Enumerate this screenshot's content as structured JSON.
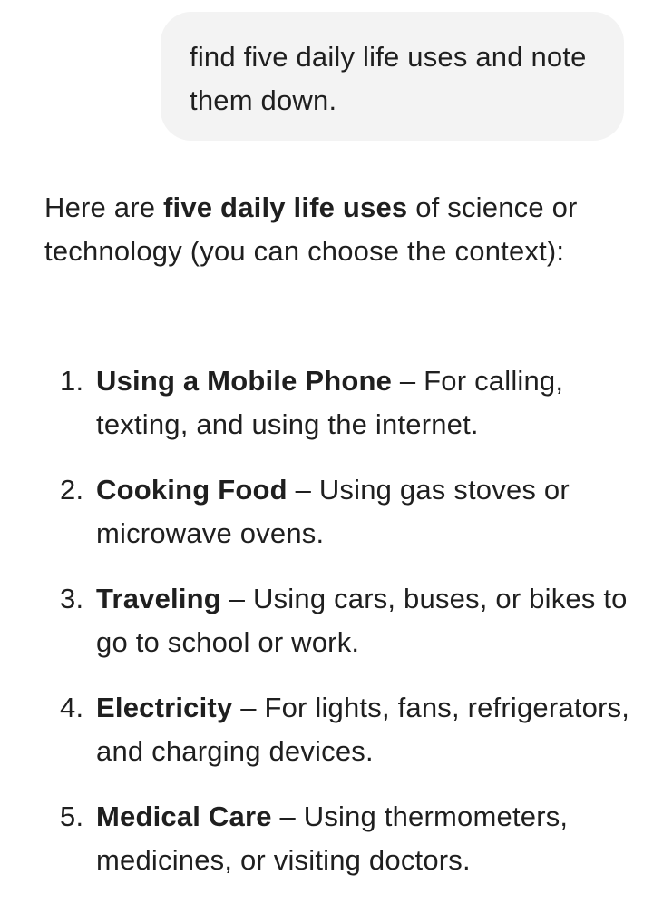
{
  "user_message": {
    "text": "find five daily life uses and note them down."
  },
  "reply": {
    "intro_before": "Here are ",
    "intro_bold": "five daily life uses",
    "intro_after": " of science or technology (you can choose the context):",
    "items": [
      {
        "number": "1.",
        "title": "Using a Mobile Phone",
        "dash": " – ",
        "text": "For calling, texting, and using the internet."
      },
      {
        "number": "2.",
        "title": "Cooking Food",
        "dash": " – ",
        "text": "Using gas stoves or microwave ovens."
      },
      {
        "number": "3.",
        "title": "Traveling",
        "dash": " – ",
        "text": "Using cars, buses, or bikes to go to school or work."
      },
      {
        "number": "4.",
        "title": "Electricity",
        "dash": " – ",
        "text": "For lights, fans, refrigerators, and charging devices."
      },
      {
        "number": "5.",
        "title": "Medical Care",
        "dash": " – ",
        "text": "Using thermometers, medicines, or visiting doctors."
      }
    ]
  },
  "colors": {
    "text": "#1f1f1f",
    "bubble_background": "#f3f3f3",
    "page_background": "#ffffff"
  }
}
